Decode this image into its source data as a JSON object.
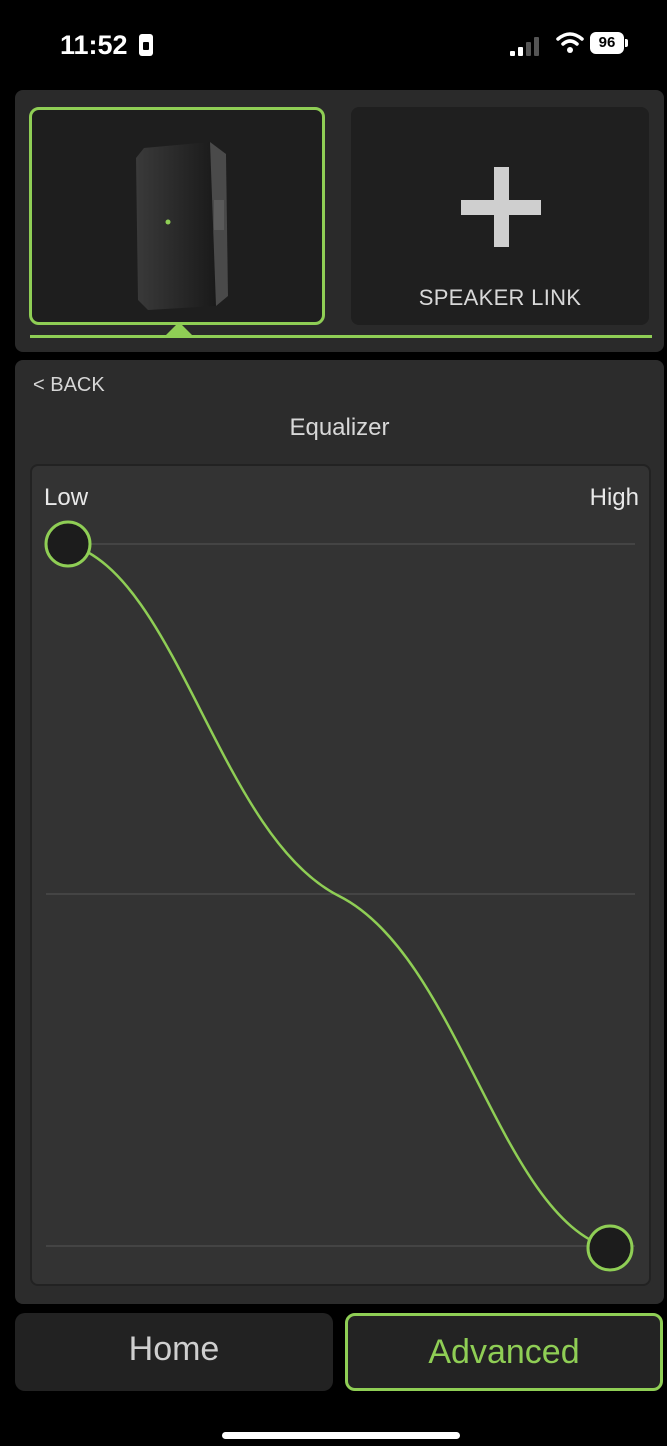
{
  "status_bar": {
    "time": "11:52",
    "battery": "96"
  },
  "devices": {
    "link_label": "SPEAKER LINK"
  },
  "equalizer": {
    "back_label": "< BACK",
    "title": "Equalizer",
    "low_label": "Low",
    "high_label": "High",
    "low_level": 1.0,
    "high_level": 0.0
  },
  "tabs": {
    "home": "Home",
    "advanced": "Advanced",
    "active": "Advanced"
  },
  "colors": {
    "accent": "#8fce55",
    "panel": "#2c2c2c",
    "background": "#000000"
  }
}
